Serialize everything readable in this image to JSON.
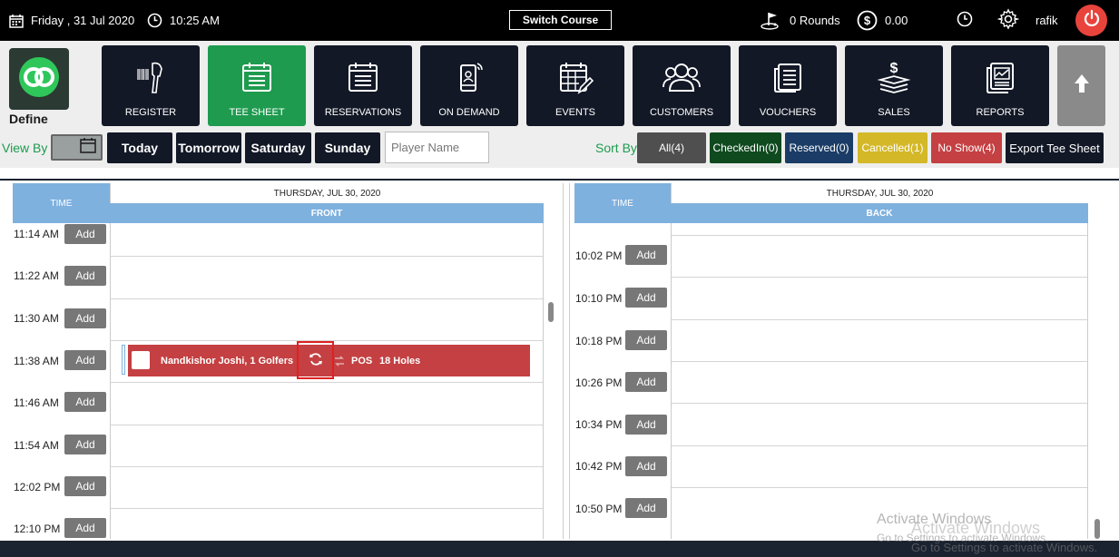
{
  "topbar": {
    "date": "Friday , 31 Jul 2020",
    "time": "10:25 AM",
    "switch_course": "Switch Course",
    "rounds": "0 Rounds",
    "balance": "0.00",
    "user": "rafik"
  },
  "brand": {
    "label": "Define"
  },
  "nav": {
    "register": "REGISTER",
    "tee_sheet": "TEE SHEET",
    "reservations": "RESERVATIONS",
    "on_demand": "ON DEMAND",
    "events": "EVENTS",
    "customers": "CUSTOMERS",
    "vouchers": "VOUCHERS",
    "sales": "SALES",
    "reports": "REPORTS"
  },
  "filters": {
    "view_by": "View By",
    "today": "Today",
    "tomorrow": "Tomorrow",
    "saturday": "Saturday",
    "sunday": "Sunday",
    "player_placeholder": "Player Name",
    "sort_by": "Sort By",
    "all": "All(4)",
    "checked_in": "CheckedIn(0)",
    "reserved": "Reserved(0)",
    "cancelled": "Cancelled(1)",
    "no_show": "No Show(4)",
    "export": "Export Tee Sheet"
  },
  "colors": {
    "active_nav": "#1e9b4f",
    "all": "#4f4f4f",
    "checked_in": "#0f4a1f",
    "reserved": "#1a3c66",
    "cancelled": "#d4b828",
    "no_show": "#c44042",
    "header_blue": "#7fb1df",
    "booking": "#c44042"
  },
  "sheet": {
    "add_label": "Add",
    "left": {
      "time_header": "TIME",
      "date": "THURSDAY, JUL 30, 2020",
      "course": "FRONT",
      "times": [
        "11:14 AM",
        "11:22 AM",
        "11:30 AM",
        "11:38 AM",
        "11:46 AM",
        "11:54 AM",
        "12:02 PM",
        "12:10 PM"
      ]
    },
    "right": {
      "time_header": "TIME",
      "date": "THURSDAY, JUL 30, 2020",
      "course": "BACK",
      "times": [
        "10:02 PM",
        "10:10 PM",
        "10:18 PM",
        "10:26 PM",
        "10:34 PM",
        "10:42 PM",
        "10:50 PM"
      ]
    },
    "booking": {
      "name": "Nandkishor  Joshi, 1 Golfers",
      "pos": "POS",
      "holes": "18 Holes"
    }
  },
  "watermark": {
    "line1": "Activate Windows",
    "line2": "Go to Settings to activate Windows."
  }
}
